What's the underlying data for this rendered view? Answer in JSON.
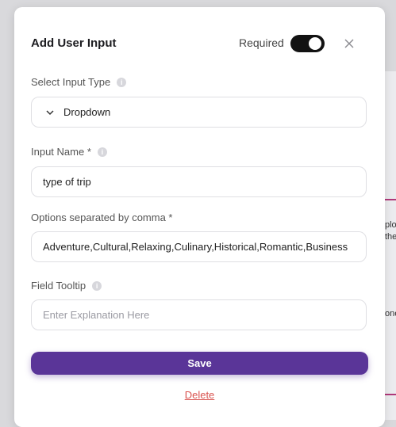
{
  "background": {
    "text_1": "plo",
    "text_2": "the",
    "text_3": "one"
  },
  "modal": {
    "title": "Add User Input",
    "required_label": "Required",
    "required_on": true
  },
  "fields": {
    "input_type": {
      "label": "Select Input Type",
      "value": "Dropdown"
    },
    "input_name": {
      "label": "Input Name *",
      "value": "type of trip"
    },
    "options": {
      "label": "Options separated by comma *",
      "value": "Adventure,Cultural,Relaxing,Culinary,Historical,Romantic,Business"
    },
    "tooltip": {
      "label": "Field Tooltip",
      "placeholder": "Enter Explanation Here"
    }
  },
  "actions": {
    "save_label": "Save",
    "delete_label": "Delete"
  },
  "colors": {
    "accent": "#5a3598",
    "danger": "#d9534f",
    "background_line": "#b0397a"
  },
  "icons": {
    "info": "info-icon",
    "close": "close-icon",
    "dropdown": "chevron-down-icon"
  }
}
